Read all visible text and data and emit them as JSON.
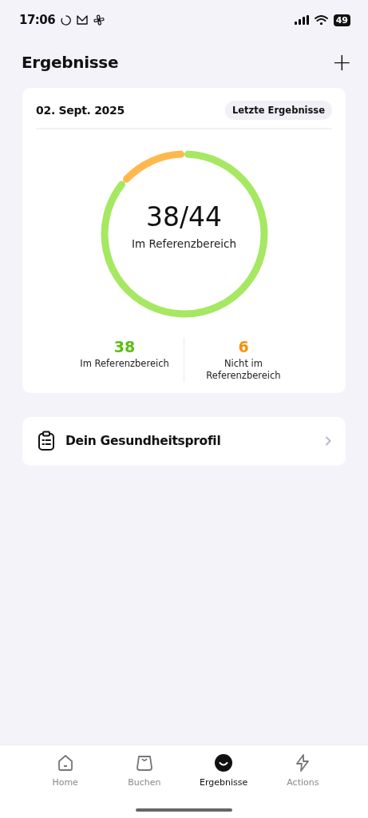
{
  "status_bar": {
    "time": "17:06",
    "battery": "49"
  },
  "header": {
    "title": "Ergebnisse",
    "add_button": "+"
  },
  "result_card": {
    "date": "02. Sept. 2025",
    "badge": "Letzte Ergebnisse",
    "score": "38/44",
    "score_label": "Im Referenzbereich",
    "stats": [
      {
        "value": "38",
        "label": "Im Referenzbereich",
        "color": "#5cbf14"
      },
      {
        "value": "6",
        "label": "Nicht im Referenzbereich",
        "color": "#f5900c"
      }
    ]
  },
  "profile_link": {
    "label": "Dein Gesundheitsprofil"
  },
  "tab_bar": [
    {
      "label": "Home",
      "kind": "home",
      "selected": false
    },
    {
      "label": "Buchen",
      "kind": "bag",
      "selected": false
    },
    {
      "label": "Ergebnisse",
      "kind": "smile",
      "selected": true
    },
    {
      "label": "Actions",
      "kind": "bolt",
      "selected": false
    }
  ]
}
